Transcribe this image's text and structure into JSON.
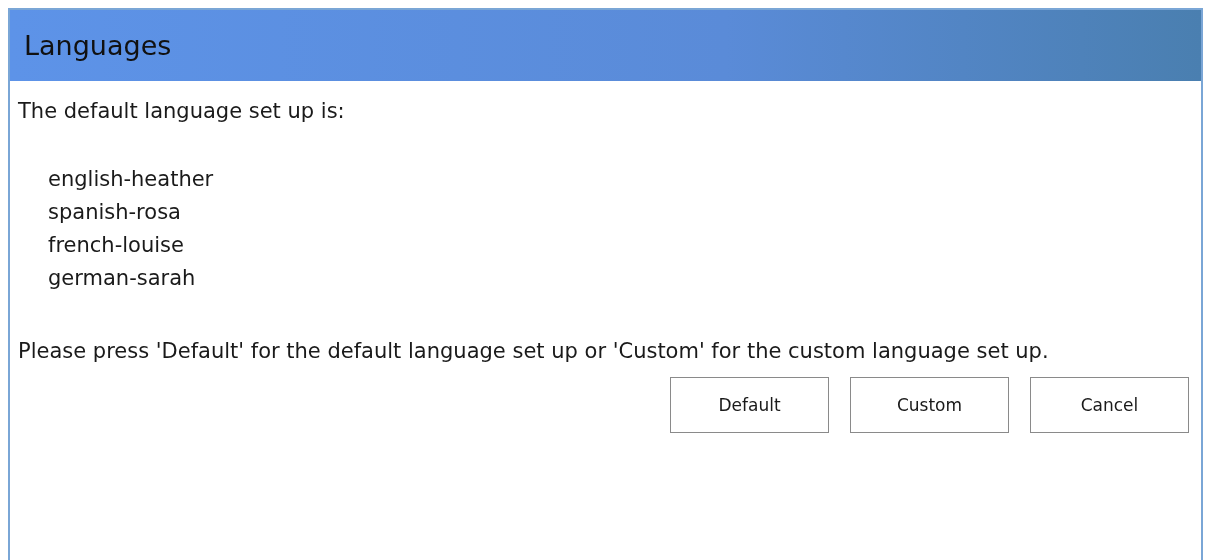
{
  "window": {
    "title": "Languages"
  },
  "intro": "The default language set up is:",
  "languages": [
    "english-heather",
    "spanish-rosa",
    "french-louise",
    "german-sarah"
  ],
  "instruction": "Please press 'Default' for the default language set up or 'Custom' for the custom language set up.",
  "buttons": [
    "Default",
    "Custom",
    "Cancel"
  ]
}
